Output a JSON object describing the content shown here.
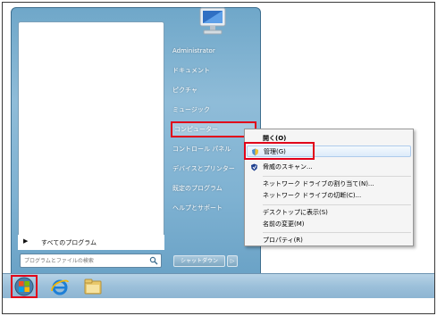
{
  "start_menu": {
    "all_programs_label": "すべてのプログラム",
    "search_placeholder": "プログラムとファイルの検索",
    "shutdown_label": "シャットダウン",
    "right_items": [
      "Administrator",
      "ドキュメント",
      "ピクチャ",
      "ミュージック",
      "コンピューター",
      "コントロール パネル",
      "デバイスとプリンター",
      "既定のプログラム",
      "ヘルプとサポート"
    ]
  },
  "context_menu": {
    "items": [
      "開く(O)",
      "管理(G)",
      "脅威のスキャン...",
      "ネットワーク ドライブの割り当て(N)...",
      "ネットワーク ドライブの切断(C)...",
      "デスクトップに表示(S)",
      "名前の変更(M)",
      "プロパティ(R)"
    ]
  },
  "colors": {
    "highlight_box": "#e1001a",
    "start_menu_blue": "#7fb2d2",
    "taskbar_blue": "#9cc0da"
  },
  "icons": {
    "user_picture": "monitor-icon",
    "manage": "shield-icon",
    "scan": "defender-icon",
    "start_orb": "windows-logo-icon",
    "browser": "internet-explorer-icon",
    "files": "folder-icon"
  }
}
